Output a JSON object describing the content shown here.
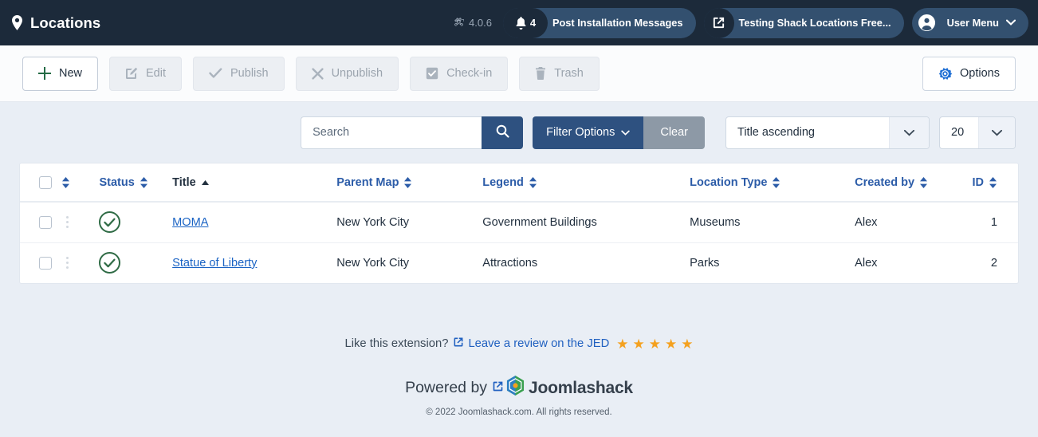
{
  "header": {
    "title": "Locations",
    "pin_icon": "map-pin-icon",
    "joomla_icon": "joomla-logo-icon",
    "version": "4.0.6",
    "messages": {
      "icon": "bell-icon",
      "count": "4",
      "label": "Post Installation Messages"
    },
    "site": {
      "icon": "external-link-icon",
      "label": "Testing Shack Locations Free..."
    },
    "user": {
      "icon": "user-circle-icon",
      "label": "User Menu",
      "chevron": "chevron-down-icon"
    }
  },
  "toolbar": {
    "buttons": [
      {
        "label": "New",
        "icon": "plus-icon",
        "state": "active"
      },
      {
        "label": "Edit",
        "icon": "pencil-square-icon",
        "state": "disabled"
      },
      {
        "label": "Publish",
        "icon": "check-icon",
        "state": "disabled"
      },
      {
        "label": "Unpublish",
        "icon": "x-icon",
        "state": "disabled"
      },
      {
        "label": "Check-in",
        "icon": "checkbox-checked-icon",
        "state": "disabled"
      },
      {
        "label": "Trash",
        "icon": "trash-icon",
        "state": "disabled"
      }
    ],
    "options": {
      "label": "Options",
      "icon": "gear-icon"
    }
  },
  "filters": {
    "search": {
      "placeholder": "Search",
      "value": "",
      "icon": "search-icon"
    },
    "filter_options": {
      "label": "Filter Options",
      "chevron": "chevron-down-icon"
    },
    "clear": {
      "label": "Clear"
    },
    "sort": {
      "value": "Title ascending",
      "chevron": "chevron-down-icon"
    },
    "limit": {
      "value": "20",
      "chevron": "chevron-down-icon"
    }
  },
  "table": {
    "select_all_icon": "checkbox-icon",
    "columns": [
      {
        "key": "ordering",
        "label": "",
        "sortable": true,
        "sorted": false
      },
      {
        "key": "status",
        "label": "Status",
        "sortable": true,
        "sorted": false
      },
      {
        "key": "title",
        "label": "Title",
        "sortable": true,
        "sorted": true,
        "direction": "ascending"
      },
      {
        "key": "parent_map",
        "label": "Parent Map",
        "sortable": true,
        "sorted": false
      },
      {
        "key": "legend",
        "label": "Legend",
        "sortable": true,
        "sorted": false
      },
      {
        "key": "location_type",
        "label": "Location Type",
        "sortable": true,
        "sorted": false
      },
      {
        "key": "created_by",
        "label": "Created by",
        "sortable": true,
        "sorted": false
      },
      {
        "key": "id",
        "label": "ID",
        "sortable": true,
        "sorted": false
      }
    ],
    "rows": [
      {
        "status": "published",
        "status_icon": "check-circle-icon",
        "title": "MOMA",
        "parent_map": "New York City",
        "legend": "Government Buildings",
        "location_type": "Museums",
        "created_by": "Alex",
        "id": "1"
      },
      {
        "status": "published",
        "status_icon": "check-circle-icon",
        "title": "Statue of Liberty",
        "parent_map": "New York City",
        "legend": "Attractions",
        "location_type": "Parks",
        "created_by": "Alex",
        "id": "2"
      }
    ]
  },
  "footer": {
    "review_prompt": "Like this extension?",
    "review_link": "Leave a review on the JED",
    "review_icon": "external-link-icon",
    "stars": 5,
    "powered_by": "Powered by",
    "powered_icon": "external-link-icon",
    "brand_icon": "joomlashack-hex-icon",
    "brand_name": "Joomlashack",
    "copyright": "© 2022 Joomlashack.com. All rights reserved."
  },
  "colors": {
    "header_bg": "#1c2a3a",
    "page_bg": "#e9eef5",
    "accent_blue": "#2e5180",
    "link_blue": "#1a63c4",
    "status_green": "#2f6b45",
    "star_orange": "#f4a11f",
    "clear_gray": "#8d99a6"
  }
}
